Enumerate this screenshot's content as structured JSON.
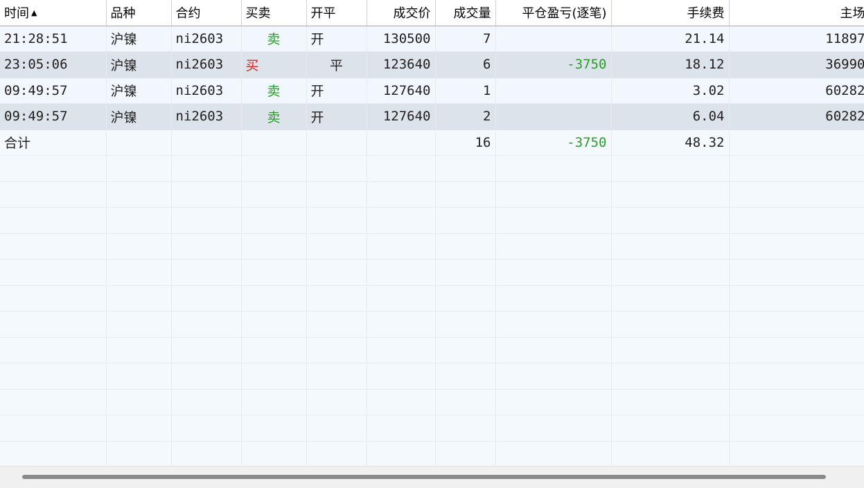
{
  "columns": [
    {
      "key": "time",
      "label": "时间",
      "sort_icon": "▲"
    },
    {
      "key": "variety",
      "label": "品种"
    },
    {
      "key": "contract",
      "label": "合约"
    },
    {
      "key": "direction",
      "label": "买卖"
    },
    {
      "key": "offset",
      "label": "开平"
    },
    {
      "key": "price",
      "label": "成交价"
    },
    {
      "key": "volume",
      "label": "成交量"
    },
    {
      "key": "pnl",
      "label": "平仓盈亏(逐笔)"
    },
    {
      "key": "fee",
      "label": "手续费"
    },
    {
      "key": "exchange_id",
      "label": "主场"
    }
  ],
  "rows": [
    {
      "time": "21:28:51",
      "variety": "沪镍",
      "contract": "ni2603",
      "direction": "卖",
      "offset": "开",
      "price": "130500",
      "volume": "7",
      "pnl": "",
      "fee": "21.14",
      "exchange_id": "11897"
    },
    {
      "time": "23:05:06",
      "variety": "沪镍",
      "contract": "ni2603",
      "direction": "买",
      "offset": "平",
      "price": "123640",
      "volume": "6",
      "pnl": "-3750",
      "fee": "18.12",
      "exchange_id": "36990"
    },
    {
      "time": "09:49:57",
      "variety": "沪镍",
      "contract": "ni2603",
      "direction": "卖",
      "offset": "开",
      "price": "127640",
      "volume": "1",
      "pnl": "",
      "fee": "3.02",
      "exchange_id": "60282"
    },
    {
      "time": "09:49:57",
      "variety": "沪镍",
      "contract": "ni2603",
      "direction": "卖",
      "offset": "开",
      "price": "127640",
      "volume": "2",
      "pnl": "",
      "fee": "6.04",
      "exchange_id": "60282"
    }
  ],
  "total": {
    "label": "合计",
    "volume": "16",
    "pnl": "-3750",
    "fee": "48.32"
  },
  "colors": {
    "sell": "#2a9b2a",
    "buy": "#e02020",
    "loss": "#2a9b2a"
  }
}
